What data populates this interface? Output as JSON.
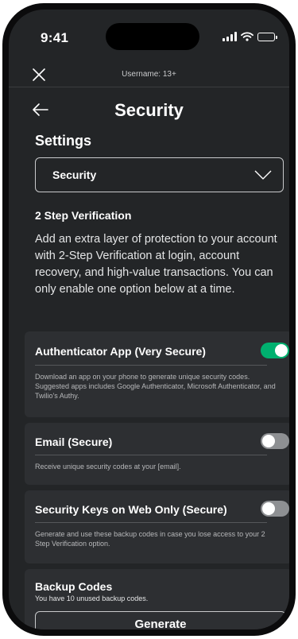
{
  "status_bar": {
    "time": "9:41"
  },
  "header": {
    "username": "Username: 13+",
    "title": "Security"
  },
  "settings": {
    "section_title": "Settings",
    "dropdown_value": "Security"
  },
  "verification": {
    "heading": "2 Step Verification",
    "description": "Add an extra layer of protection to your account with 2-Step Verification at login, account recovery, and high-value transactions. You can only enable one option below at a time."
  },
  "options": [
    {
      "label": "Authenticator App (Very Secure)",
      "enabled": true,
      "detail": "Download an app on your phone to generate unique security codes. Suggested apps includes Google Authenticator, Microsoft Authenticator, and Twilio's Authy."
    },
    {
      "label": "Email (Secure)",
      "enabled": false,
      "detail": "Receive unique security codes at your [email]."
    },
    {
      "label": "Security Keys on Web Only (Secure)",
      "enabled": false,
      "detail": "Generate and use these backup codes in case you lose access to your 2 Step Verification option."
    }
  ],
  "backup": {
    "title": "Backup Codes",
    "subtitle": "You have 10 unused backup codes.",
    "button_label": "Generate"
  },
  "colors": {
    "background": "#232527",
    "card": "#2d2f32",
    "toggle_on": "#00b06f",
    "toggle_off": "#8e9093"
  },
  "icons": [
    "close-icon",
    "back-arrow-icon",
    "chevron-down-icon",
    "signal-icon",
    "wifi-icon",
    "battery-icon"
  ]
}
